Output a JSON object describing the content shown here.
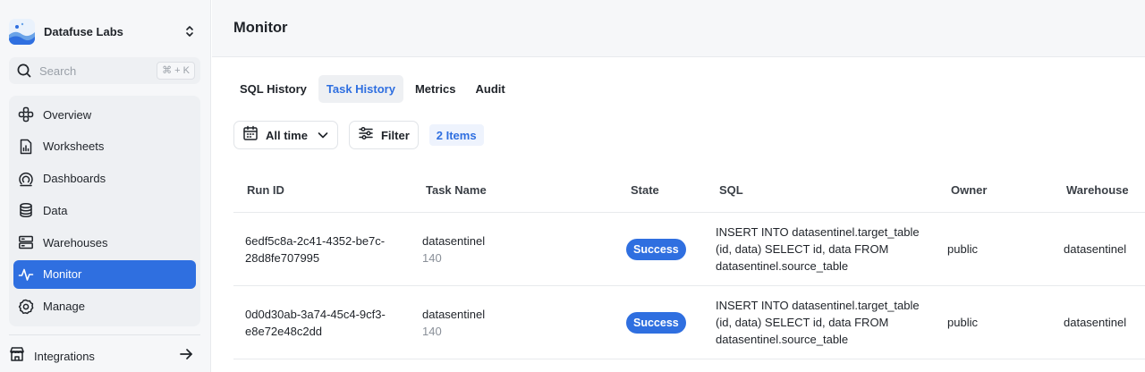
{
  "org": {
    "name": "Datafuse Labs"
  },
  "search": {
    "placeholder": "Search",
    "shortcut": "⌘ + K"
  },
  "sidebar": {
    "items": [
      {
        "id": "overview",
        "label": "Overview",
        "icon": "overview-icon"
      },
      {
        "id": "worksheets",
        "label": "Worksheets",
        "icon": "worksheet-icon"
      },
      {
        "id": "dashboards",
        "label": "Dashboards",
        "icon": "dashboard-icon"
      },
      {
        "id": "data",
        "label": "Data",
        "icon": "database-icon"
      },
      {
        "id": "warehouses",
        "label": "Warehouses",
        "icon": "server-icon"
      },
      {
        "id": "monitor",
        "label": "Monitor",
        "icon": "pulse-icon",
        "active": true
      },
      {
        "id": "manage",
        "label": "Manage",
        "icon": "gear-icon"
      }
    ],
    "integrations": {
      "label": "Integrations"
    }
  },
  "header": {
    "title": "Monitor"
  },
  "tabs": [
    {
      "label": "SQL History"
    },
    {
      "label": "Task History",
      "active": true
    },
    {
      "label": "Metrics"
    },
    {
      "label": "Audit"
    }
  ],
  "toolbar": {
    "time_label": "All time",
    "filter_label": "Filter",
    "count_label": "2 Items"
  },
  "table": {
    "columns": [
      "Run ID",
      "Task Name",
      "State",
      "SQL",
      "Owner",
      "Warehouse"
    ],
    "rows": [
      {
        "run_id_1": "6edf5c8a-2c41-4352-be7c-",
        "run_id_2": "28d8fe707995",
        "task_name": "datasentinel",
        "task_sub": "140",
        "state": "Success",
        "sql_1": "INSERT INTO datasentinel.target_table",
        "sql_2": "(id, data) SELECT id, data FROM",
        "sql_3": "datasentinel.source_table",
        "owner": "public",
        "warehouse": "datasentinel"
      },
      {
        "run_id_1": "0d0d30ab-3a74-45c4-9cf3-",
        "run_id_2": "e8e72e48c2dd",
        "task_name": "datasentinel",
        "task_sub": "140",
        "state": "Success",
        "sql_1": "INSERT INTO datasentinel.target_table",
        "sql_2": "(id, data) SELECT id, data FROM",
        "sql_3": "datasentinel.source_table",
        "owner": "public",
        "warehouse": "datasentinel"
      }
    ]
  },
  "colors": {
    "accent": "#2f6fe0",
    "sidebar_bg": "#f6f7f9",
    "nav_card_bg": "#eef0f3",
    "badge_bg": "#eef3fd"
  }
}
